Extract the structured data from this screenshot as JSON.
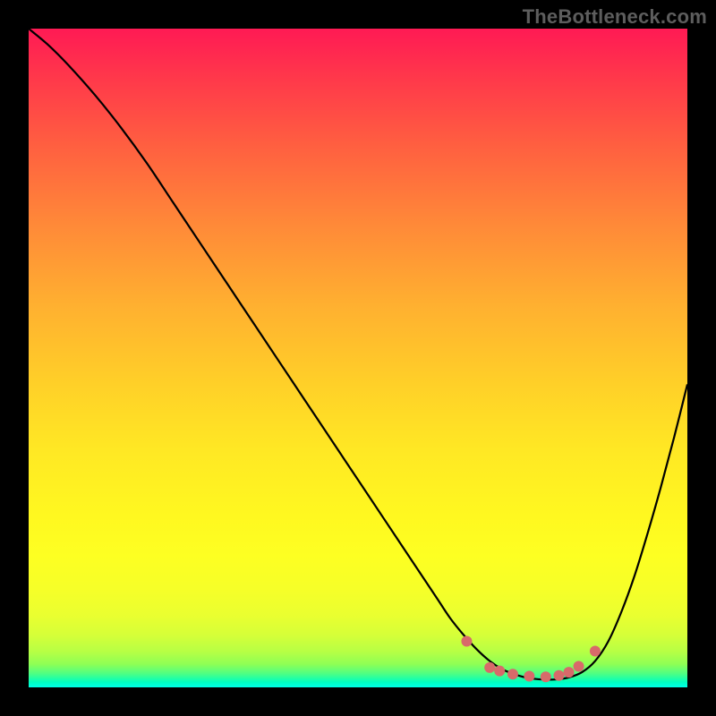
{
  "watermark": "TheBottleneck.com",
  "colors": {
    "background": "#000000",
    "curve": "#000000",
    "dots": "#d86a6a",
    "gradient_top": "#ff1a54",
    "gradient_bottom": "#00ffe8"
  },
  "chart_data": {
    "type": "line",
    "title": "",
    "xlabel": "",
    "ylabel": "",
    "xlim": [
      0,
      100
    ],
    "ylim": [
      0,
      100
    ],
    "x": [
      0,
      3,
      6,
      10,
      14,
      18,
      22,
      26,
      30,
      34,
      38,
      42,
      46,
      50,
      54,
      58,
      62,
      64,
      66,
      68,
      70,
      72,
      74,
      76,
      78,
      80,
      82,
      84,
      86,
      88,
      90,
      92,
      94,
      96,
      98,
      100
    ],
    "y": [
      100,
      97.5,
      94.5,
      90,
      85,
      79.5,
      73.5,
      67.5,
      61.5,
      55.5,
      49.5,
      43.5,
      37.5,
      31.5,
      25.5,
      19.5,
      13.5,
      10.5,
      8,
      5.8,
      4,
      2.7,
      1.9,
      1.4,
      1.2,
      1.2,
      1.5,
      2.3,
      4,
      7,
      11.5,
      17,
      23.5,
      30.5,
      38,
      46
    ],
    "dots": [
      {
        "x": 66.5,
        "y": 7.0
      },
      {
        "x": 70.0,
        "y": 3.0
      },
      {
        "x": 71.5,
        "y": 2.5
      },
      {
        "x": 73.5,
        "y": 2.0
      },
      {
        "x": 76.0,
        "y": 1.7
      },
      {
        "x": 78.5,
        "y": 1.6
      },
      {
        "x": 80.5,
        "y": 1.8
      },
      {
        "x": 82.0,
        "y": 2.3
      },
      {
        "x": 83.5,
        "y": 3.2
      },
      {
        "x": 86.0,
        "y": 5.5
      }
    ]
  }
}
